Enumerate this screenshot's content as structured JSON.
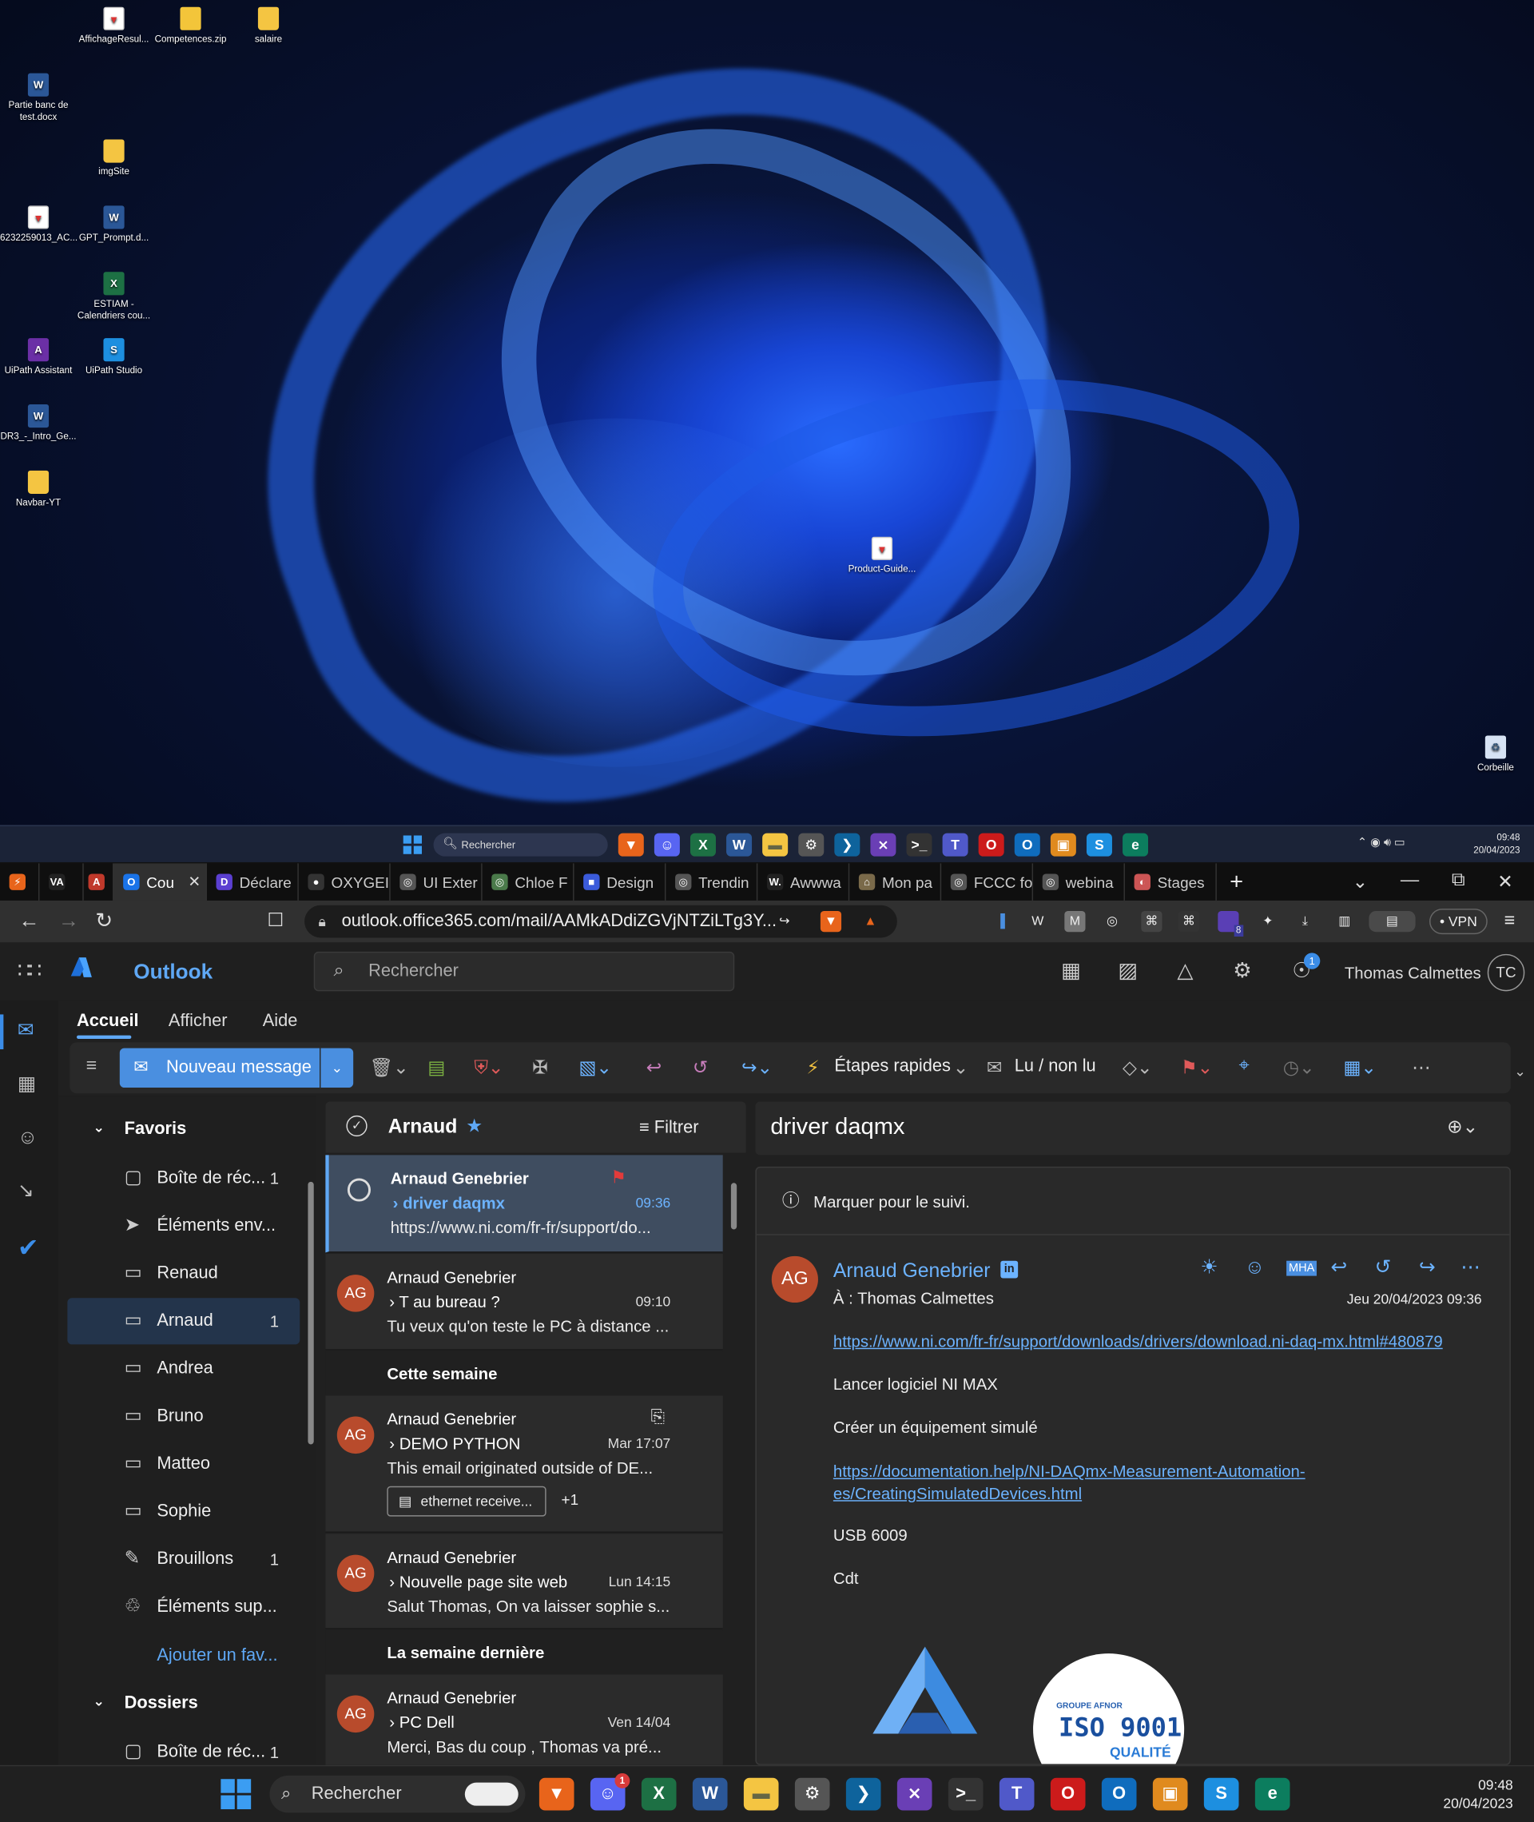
{
  "desktop": {
    "icons": [
      {
        "label": "AffichageResul...",
        "type": "pdf",
        "glyph": "▼"
      },
      {
        "label": "Competences.zip",
        "type": "zip",
        "glyph": ""
      },
      {
        "label": "salaire",
        "type": "folder",
        "glyph": ""
      },
      {
        "label": "Partie banc de test.docx",
        "type": "word",
        "glyph": "W"
      },
      {
        "label": "imgSite",
        "type": "folder",
        "glyph": ""
      },
      {
        "label": "6232259013_AC...",
        "type": "pdf",
        "glyph": "▼"
      },
      {
        "label": "GPT_Prompt.d...",
        "type": "word",
        "glyph": "W"
      },
      {
        "label": "ESTIAM - Calendriers cou...",
        "type": "excel",
        "glyph": "X"
      },
      {
        "label": "UiPath Assistant",
        "type": "uia",
        "glyph": "A"
      },
      {
        "label": "UiPath Studio",
        "type": "uis",
        "glyph": "S"
      },
      {
        "label": "DR3_-_Intro_Ge...",
        "type": "word",
        "glyph": "W"
      },
      {
        "label": "Navbar-YT",
        "type": "folder",
        "glyph": ""
      },
      {
        "label": "Product-Guide...",
        "type": "pdf",
        "glyph": "▼"
      },
      {
        "label": "Corbeille",
        "type": "bin",
        "glyph": "♻"
      }
    ]
  },
  "taskbar_top": {
    "search_placeholder": "Rechercher",
    "time": "09:48",
    "date": "20/04/2023"
  },
  "browser": {
    "tabs": [
      {
        "label": "",
        "color": "#e8641b",
        "glyph": "⚡"
      },
      {
        "label": "",
        "color": "#222",
        "glyph": "VA"
      },
      {
        "label": "",
        "color": "#c0392b",
        "glyph": "A"
      },
      {
        "label": "Cou",
        "color": "#1a73e8",
        "glyph": "O",
        "active": true
      },
      {
        "label": "Déclare",
        "color": "#5b3fd1",
        "glyph": "D"
      },
      {
        "label": "OXYGEI",
        "color": "#333",
        "glyph": "●"
      },
      {
        "label": "UI Exter",
        "color": "#555",
        "glyph": "◎"
      },
      {
        "label": "Chloe F",
        "color": "#4a7a4a",
        "glyph": "◎"
      },
      {
        "label": "Design",
        "color": "#3b5bdb",
        "glyph": "■"
      },
      {
        "label": "Trendin",
        "color": "#555",
        "glyph": "◎"
      },
      {
        "label": "Awwwa",
        "color": "#222",
        "glyph": "W."
      },
      {
        "label": "Mon pa",
        "color": "#7a6a4a",
        "glyph": "⌂"
      },
      {
        "label": "FCCC fo",
        "color": "#555",
        "glyph": "◎"
      },
      {
        "label": "webina",
        "color": "#555",
        "glyph": "◎"
      },
      {
        "label": "Stages",
        "color": "#cc5555",
        "glyph": "◐"
      }
    ],
    "url": "outlook.office365.com/mail/AAMkADdiZGVjNTZiLTg3Y...",
    "vpn_label": "VPN",
    "ext_badge": "8"
  },
  "outlook": {
    "brand": "Outlook",
    "search_placeholder": "Rechercher",
    "user_name": "Thomas Calmettes",
    "user_initials": "TC",
    "notif_count": "1",
    "ribbon_tabs": [
      "Accueil",
      "Afficher",
      "Aide"
    ],
    "new_message_label": "Nouveau message",
    "quick_steps_label": "Étapes rapides",
    "read_unread_label": "Lu / non lu",
    "folders": {
      "favorites_label": "Favoris",
      "items": [
        {
          "label": "Boîte de réc...",
          "count": "1",
          "icon": "▢"
        },
        {
          "label": "Éléments env...",
          "count": "",
          "icon": "➤"
        },
        {
          "label": "Renaud",
          "count": "",
          "icon": "▭"
        },
        {
          "label": "Arnaud",
          "count": "1",
          "icon": "▭",
          "selected": true
        },
        {
          "label": "Andrea",
          "count": "",
          "icon": "▭"
        },
        {
          "label": "Bruno",
          "count": "",
          "icon": "▭"
        },
        {
          "label": "Matteo",
          "count": "",
          "icon": "▭"
        },
        {
          "label": "Sophie",
          "count": "",
          "icon": "▭"
        },
        {
          "label": "Brouillons",
          "count": "1",
          "icon": "✎"
        },
        {
          "label": "Éléments sup...",
          "count": "",
          "icon": "♲"
        }
      ],
      "add_favorite_label": "Ajouter un fav...",
      "folders_label": "Dossiers",
      "folders_first_item": "Boîte de réc...",
      "folders_first_count": "1"
    },
    "message_list": {
      "folder_name": "Arnaud",
      "filter_label": "Filtrer",
      "groups": {
        "this_week": "Cette semaine",
        "last_week": "La semaine dernière"
      },
      "messages": [
        {
          "from": "Arnaud Genebrier",
          "subject": "driver daqmx",
          "time": "09:36",
          "preview": "https://www.ni.com/fr-fr/support/do...",
          "initials": "",
          "selected": true,
          "flagged": true
        },
        {
          "from": "Arnaud Genebrier",
          "subject": "T au bureau ?",
          "time": "09:10",
          "preview": "Tu veux qu'on teste le PC à distance ...",
          "initials": "AG"
        },
        {
          "from": "Arnaud Genebrier",
          "subject": "DEMO PYTHON",
          "time": "Mar 17:07",
          "preview": "This email originated outside of DE...",
          "initials": "AG",
          "attachment": "ethernet receive...",
          "attachment_more": "+1"
        },
        {
          "from": "Arnaud Genebrier",
          "subject": "Nouvelle page site web",
          "time": "Lun 14:15",
          "preview": "Salut Thomas, On va laisser sophie s...",
          "initials": "AG"
        },
        {
          "from": "Arnaud Genebrier",
          "subject": "PC Dell",
          "time": "Ven 14/04",
          "preview": "Merci, Bas du coup , Thomas va pré...",
          "initials": "AG"
        }
      ]
    },
    "reading": {
      "subject": "driver daqmx",
      "follow_up": "Marquer pour le suivi.",
      "sender_name": "Arnaud Genebrier",
      "sender_initials": "AG",
      "to_line": "À :  Thomas Calmettes",
      "date": "Jeu 20/04/2023 09:36",
      "link1": "https://www.ni.com/fr-fr/support/downloads/drivers/download.ni-daq-mx.html#480879",
      "line1": "Lancer logiciel NI MAX",
      "line2": "Créer un équipement simulé",
      "link2a": "https://documentation.help/NI-DAQmx-Measurement-Automation-",
      "link2b": "es/CreatingSimulatedDevices.html",
      "line3": "USB 6009",
      "line4": "Cdt",
      "iso_small": "GROUPE AFNOR",
      "iso_big": "ISO 9001",
      "iso_quality": "QUALITÉ"
    }
  },
  "taskbar_bottom": {
    "search_placeholder": "Rechercher",
    "time": "09:48",
    "date": "20/04/2023",
    "discord_badge": "1"
  }
}
